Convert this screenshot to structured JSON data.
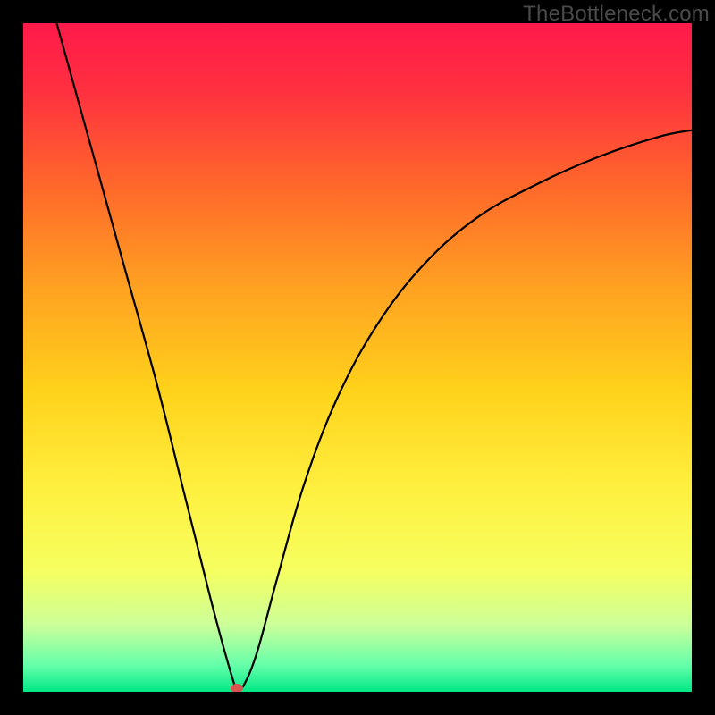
{
  "watermark": "TheBottleneck.com",
  "chart_data": {
    "type": "line",
    "title": "",
    "xlabel": "",
    "ylabel": "",
    "xlim": [
      0,
      100
    ],
    "ylim": [
      0,
      100
    ],
    "grid": false,
    "legend": false,
    "background": "rainbow-gradient-red-to-green",
    "series": [
      {
        "name": "bottleneck-curve",
        "x": [
          5,
          10,
          15,
          20,
          24,
          28,
          31,
          32,
          33,
          35,
          38,
          42,
          47,
          53,
          60,
          68,
          77,
          86,
          95,
          100
        ],
        "y": [
          100,
          82,
          64,
          46,
          30,
          14,
          3,
          0.5,
          1,
          6,
          17,
          31,
          44,
          55,
          64,
          71,
          76,
          80,
          83,
          84
        ]
      }
    ],
    "annotations": [
      {
        "type": "marker",
        "shape": "ellipse",
        "x": 32,
        "y": 0.5,
        "color": "#d9534f"
      }
    ],
    "colors": {
      "curve": "#000000",
      "gradient_stops": [
        {
          "pos": 0.0,
          "color": "#ff1a4a"
        },
        {
          "pos": 0.1,
          "color": "#ff3040"
        },
        {
          "pos": 0.25,
          "color": "#ff6a2a"
        },
        {
          "pos": 0.4,
          "color": "#ffa321"
        },
        {
          "pos": 0.55,
          "color": "#ffd21a"
        },
        {
          "pos": 0.7,
          "color": "#fff040"
        },
        {
          "pos": 0.82,
          "color": "#f5ff60"
        },
        {
          "pos": 0.9,
          "color": "#ccff99"
        },
        {
          "pos": 0.96,
          "color": "#66ffaa"
        },
        {
          "pos": 1.0,
          "color": "#00e885"
        }
      ]
    }
  }
}
